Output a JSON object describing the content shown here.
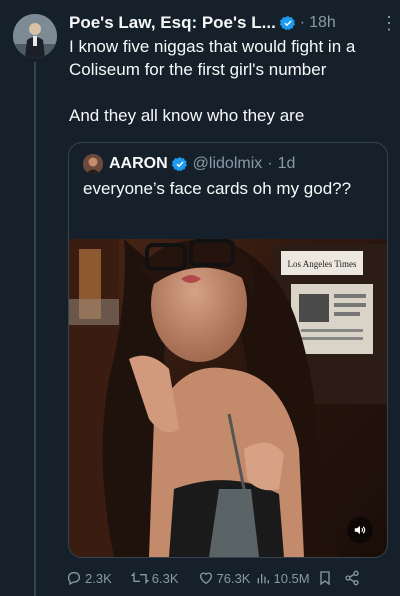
{
  "post": {
    "display_name": "Poe's Law, Esq: Poe's L...",
    "time": "18h",
    "text_line1": "I know five niggas that would fight in a Coliseum for the first girl's number",
    "text_line2": "And they all know who they are"
  },
  "quote": {
    "display_name": "AARON",
    "handle": "@lidolmix",
    "time": "1d",
    "text": "everyone’s face cards oh my god??",
    "media_sign_text": "Los Angeles Times"
  },
  "actions": {
    "replies": "2.3K",
    "reposts": "6.3K",
    "likes": "76.3K",
    "views": "10.5M"
  },
  "colors": {
    "background": "#15202b",
    "verified": "#1d9bf0",
    "muted": "#8b98a5"
  }
}
